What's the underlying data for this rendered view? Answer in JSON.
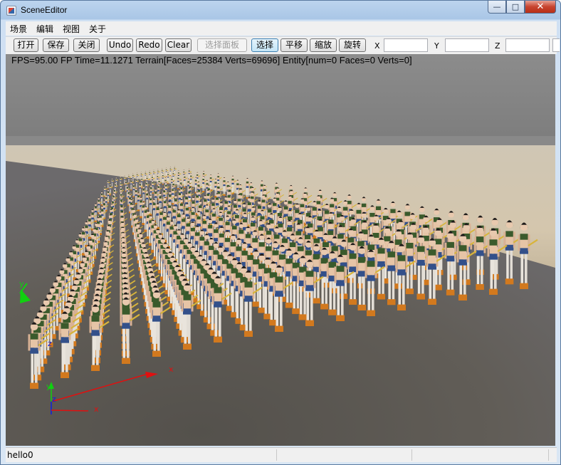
{
  "window": {
    "title": "SceneEditor",
    "minimize_glyph": "—",
    "restore_glyph": "□",
    "close_glyph": "✕"
  },
  "menu": {
    "items": [
      "场景",
      "编辑",
      "视图",
      "关于"
    ]
  },
  "toolbar": {
    "open": "打开",
    "save": "保存",
    "close": "关闭",
    "undo": "Undo",
    "redo": "Redo",
    "clear": "Clear",
    "select_panel": "选择面板",
    "select": "选择",
    "translate": "平移",
    "scale": "缩放",
    "rotate": "旋转",
    "x_label": "X",
    "y_label": "Y",
    "z_label": "Z",
    "x_value": "",
    "y_value": "",
    "z_value": ""
  },
  "viewport": {
    "stats": "FPS=95.00 FP Time=11.1271  Terrain[Faces=25384 Verts=69696] Entity[num=0 Faces=0 Verts=0]",
    "gizmo_small": {
      "x": "x",
      "y": "y",
      "z": "z"
    },
    "gizmo_large": {
      "x": "x",
      "y": "y",
      "z": "z"
    }
  },
  "status": {
    "text": "hello0"
  },
  "colors": {
    "sky": "#8a8a8a",
    "ground": "#5e5b56",
    "axis_x": "#e01010",
    "axis_y": "#10d010",
    "axis_z": "#1020e0",
    "active_tool": "#c4e5f6"
  }
}
